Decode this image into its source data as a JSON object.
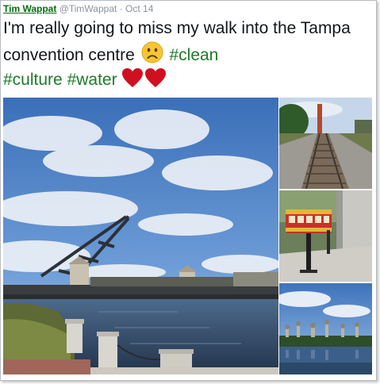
{
  "tweet": {
    "author_name": "Tim Wappat",
    "handle": "@TimWappat",
    "separator": "·",
    "date": "Oct 14",
    "text_parts": [
      "I'm really going to miss my walk into the Tampa convention centre",
      "#clean",
      "#culture",
      "#water"
    ],
    "emojis": [
      "sad-face",
      "red-heart",
      "red-heart"
    ]
  },
  "colors": {
    "author": "#0a6a12",
    "hashtag": "#1f7a2a",
    "meta": "#8a939b",
    "text": "#14171a",
    "heart": "#d0101e",
    "sad_emoji": "#f6c531"
  },
  "media": {
    "photo_count": 4,
    "photos": [
      {
        "subject": "drawbridge-over-river"
      },
      {
        "subject": "railroad-tracks"
      },
      {
        "subject": "trolley-model-sculpture"
      },
      {
        "subject": "skyline-minarets-water"
      }
    ]
  }
}
